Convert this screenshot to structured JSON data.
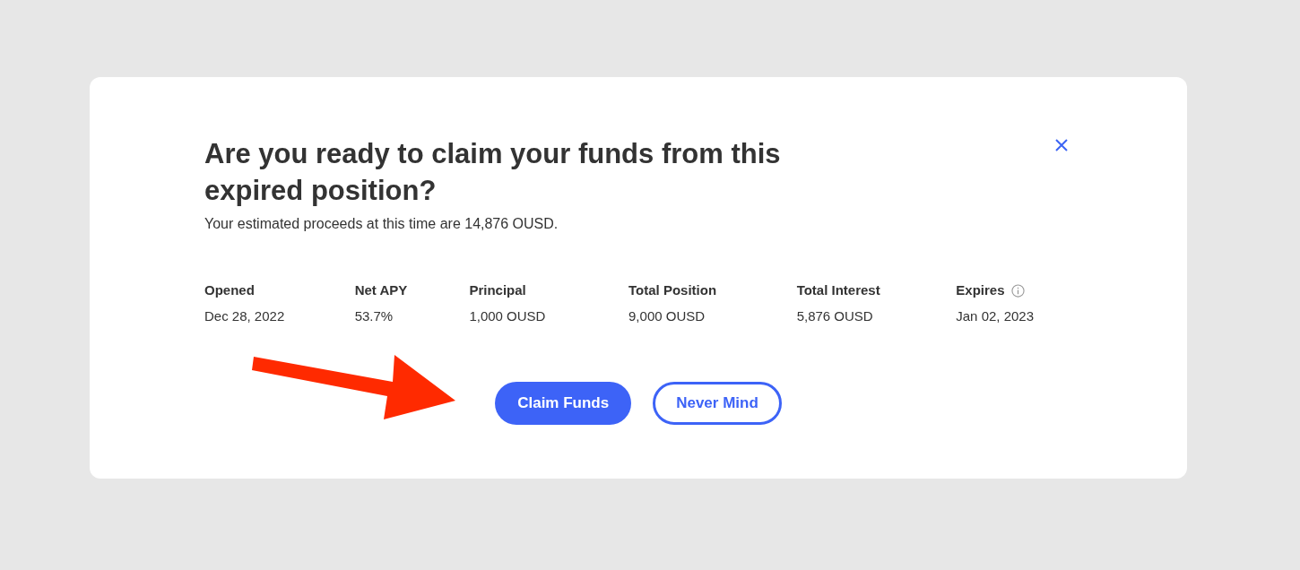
{
  "dialog": {
    "title": "Are you ready to claim your funds from this expired position?",
    "subtitle": "Your estimated proceeds at this time are 14,876 OUSD.",
    "stats": [
      {
        "label": "Opened",
        "value": "Dec 28, 2022",
        "info": false
      },
      {
        "label": "Net APY",
        "value": "53.7%",
        "info": false
      },
      {
        "label": "Principal",
        "value": "1,000 OUSD",
        "info": false
      },
      {
        "label": "Total Position",
        "value": "9,000 OUSD",
        "info": false
      },
      {
        "label": "Total Interest",
        "value": "5,876 OUSD",
        "info": false
      },
      {
        "label": "Expires",
        "value": "Jan 02, 2023",
        "info": true
      }
    ],
    "buttons": [
      {
        "label": "Claim Funds",
        "kind": "primary"
      },
      {
        "label": "Never Mind",
        "kind": "secondary"
      }
    ]
  }
}
